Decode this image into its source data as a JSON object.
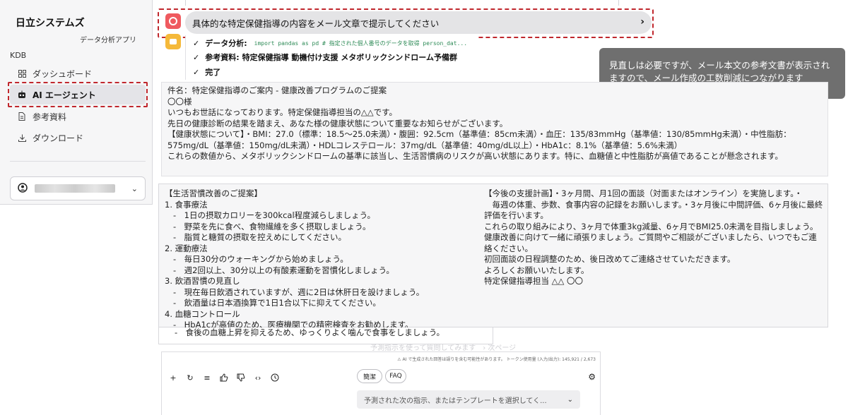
{
  "sidebar": {
    "brand": "日立システムズ",
    "subtitle": "データ分析アプリ",
    "section": "KDB",
    "items": [
      {
        "label": "ダッシュボード",
        "icon": "grid-icon"
      },
      {
        "label": "AI エージェント",
        "icon": "robot-icon"
      },
      {
        "label": "参考資料",
        "icon": "document-icon"
      },
      {
        "label": "ダウンロード",
        "icon": "download-icon"
      }
    ],
    "user_chevron": "⌄"
  },
  "question": {
    "text": "具体的な特定保健指導の内容をメール文章で提示してください",
    "chevron": "›"
  },
  "steps": [
    {
      "label": "データ分析:",
      "detail": "",
      "code": "import pandas as pd  # 指定された個人番号のデータを取得 person_dat..."
    },
    {
      "label": "参考資料:",
      "detail": "特定保健指導 動機付け支援 メタボリックシンドローム予備群",
      "code": ""
    },
    {
      "label": "完了",
      "detail": "",
      "code": ""
    }
  ],
  "callout": "見直しは必要ですが、メール本文の参考文書が表示されますので、メール作成の工数削減につながります",
  "email_top": [
    "件名：特定保健指導のご案内 - 健康改善プログラムのご提案",
    "〇〇様",
    "いつもお世話になっております。特定保健指導担当の△△です。",
    "先日の健康診断の結果を踏まえ、あなた様の健康状態について重要なお知らせがございます。",
    "【健康状態について】・BMI：27.0（標準：18.5〜25.0未満）・腹囲：92.5cm（基準値：85cm未満）・血圧：135/83mmHg（基準値：130/85mmHg未満）・中性脂肪：575mg/dL（基準値：150mg/dL未満）・HDLコレステロール：37mg/dL（基準値：40mg/dL以上）・HbA1c：8.1%（基準値：5.6%未満）",
    "これらの数値から、メタボリックシンドロームの基準に該当し、生活習慣病のリスクが高い状態にあります。特に、血糖値と中性脂肪が高値であることが懸念されます。"
  ],
  "email_left": {
    "heading": "【生活習慣改善のご提案】",
    "sections": [
      {
        "title": "1. 食事療法",
        "bullets": [
          "1日の摂取カロリーを300kcal程度減らしましょう。",
          "野菜を先に食べ、食物繊維を多く摂取しましょう。",
          "脂質と糖質の摂取を控えめにしてください。"
        ]
      },
      {
        "title": "2. 運動療法",
        "bullets": [
          "毎日30分のウォーキングから始めましょう。",
          "週2回以上、30分以上の有酸素運動を習慣化しましょう。"
        ]
      },
      {
        "title": "3. 飲酒習慣の見直し",
        "bullets": [
          "現在毎日飲酒されていますが、週に2日は休肝日を設けましょう。",
          "飲酒量は日本酒換算で1日1合以下に抑えてください。"
        ]
      },
      {
        "title": "4. 血糖コントロール",
        "bullets": [
          "HbA1cが高値のため、医療機関での精密検査をお勧めします。"
        ]
      }
    ],
    "tail": "-　食後の血糖上昇を抑えるため、ゆっくりよく噛んで食事をしましょう。"
  },
  "email_right": [
    "【今後の支援計画】・3ヶ月間、月1回の面談（対面またはオンライン）を実施します。・",
    "　毎週の体重、歩数、食事内容の記録をお願いします。・3ヶ月後に中間評価、6ヶ月後に最終評価を行います。",
    "これらの取り組みにより、3ヶ月で体重3kg減量、6ヶ月でBMI25.0未満を目指しましょう。",
    "健康改善に向けて一緒に頑張りましょう。ご質問やご相談がございましたら、いつでもご連絡ください。",
    "初回面談の日程調整のため、後日改めてご連絡させていただきます。",
    "よろしくお願いいたします。",
    "特定保健指導担当 △△ 〇〇"
  ],
  "ghost_text": "予測指示を使って質問してみます　›  次ページ",
  "input": {
    "disclaimer": "⚠ AI で生成された回答は誤りを含む可能性があります。 トークン使用量 (入力/出力): 145,921 / 2,673",
    "chips": [
      "簡潔",
      "FAQ"
    ],
    "template_placeholder": "予測された次の指示、またはテンプレートを選択してく...",
    "template_chevron": "⌄"
  }
}
